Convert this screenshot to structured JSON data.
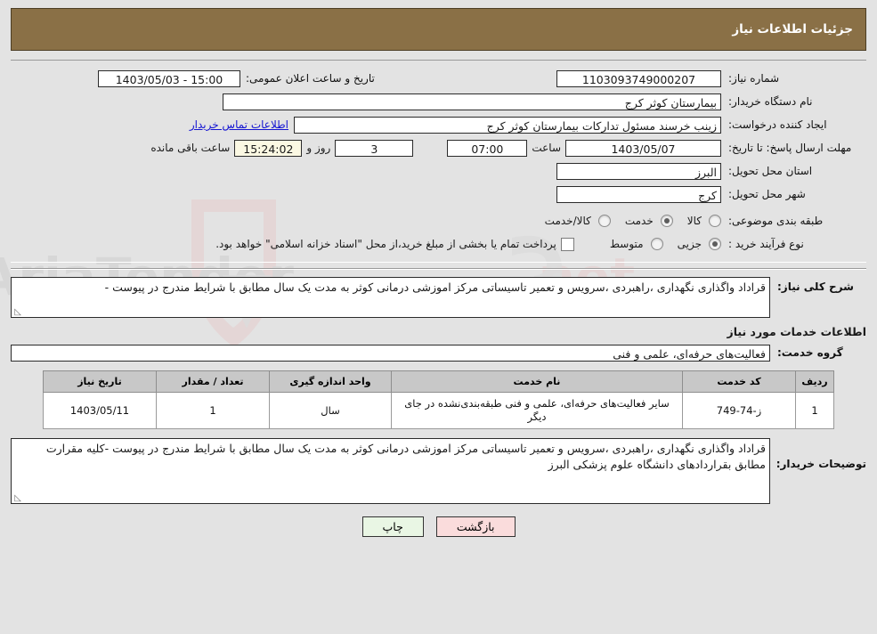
{
  "header": {
    "title": "جزئیات اطلاعات نیاز",
    "bg_color": "#8a7046"
  },
  "fields": {
    "need_number_label": "شماره نیاز:",
    "need_number_value": "1103093749000207",
    "public_announce_label": "تاریخ و ساعت اعلان عمومی:",
    "public_announce_value": "15:00 - 1403/05/03",
    "buyer_org_label": "نام دستگاه خریدار:",
    "buyer_org_value": "بیمارستان کوثر کرج",
    "request_creator_label": "ایجاد کننده درخواست:",
    "request_creator_value": "زینب خرسند مسئول تدارکات بیمارستان کوثر کرج",
    "buyer_contact_link": "اطلاعات تماس خریدار",
    "deadline_label": "مهلت ارسال پاسخ: تا تاریخ:",
    "deadline_date": "1403/05/07",
    "deadline_time_label": "ساعت",
    "deadline_time": "07:00",
    "remaining_days": "3",
    "remaining_days_label": "روز و",
    "remaining_clock": "15:24:02",
    "remaining_clock_label": "ساعت باقی مانده",
    "delivery_province_label": "استان محل تحویل:",
    "delivery_province_value": "البرز",
    "delivery_city_label": "شهر محل تحویل:",
    "delivery_city_value": "کرج",
    "subject_class_label": "طبقه بندی موضوعی:",
    "subject_class_options": [
      "کالا",
      "خدمت",
      "کالا/خدمت"
    ],
    "subject_class_selected": "خدمت",
    "purchase_type_label": "نوع فرآیند خرید :",
    "purchase_type_options": [
      "جزیی",
      "متوسط"
    ],
    "purchase_type_selected": "جزیی",
    "treasury_note": "پرداخت تمام یا بخشی از مبلغ خرید،از محل \"اسناد خزانه اسلامی\" خواهد بود.",
    "treasury_checked": false,
    "general_desc_label": "شرح کلی نیاز:",
    "general_desc_value": "قراداد واگذاری نگهداری ،راهبردی ،سرویس و تعمیر تاسیساتی مرکز اموزشی درمانی کوثر به مدت یک سال مطابق با شرایط مندرج در پیوست -",
    "services_section_title": "اطلاعات خدمات مورد نیاز",
    "service_group_label": "گروه خدمت:",
    "service_group_value": "فعالیت‌های حرفه‌ای، علمی و فنی",
    "buyer_notes_label": "توضیحات خریدار:",
    "buyer_notes_value": "قراداد واگذاری نگهداری ،راهبردی ،سرویس و تعمیر تاسیساتی مرکز اموزشی درمانی کوثر به مدت یک سال مطابق با شرایط مندرج در پیوست -کلیه مقرارت مطابق بقراردادهای دانشگاه علوم پزشکی البرز"
  },
  "table": {
    "headers": [
      "ردیف",
      "کد خدمت",
      "نام خدمت",
      "واحد اندازه گیری",
      "تعداد / مقدار",
      "تاریخ نیاز"
    ],
    "rows": [
      {
        "index": "1",
        "code": "ز-74-749",
        "name": "سایر فعالیت‌های حرفه‌ای، علمی و فنی طبقه‌بندی‌نشده در جای دیگر",
        "unit": "سال",
        "quantity": "1",
        "need_date": "1403/05/11"
      }
    ]
  },
  "buttons": {
    "print": "چاپ",
    "back": "بازگشت"
  },
  "watermark": {
    "text": "AriaTender.net"
  }
}
